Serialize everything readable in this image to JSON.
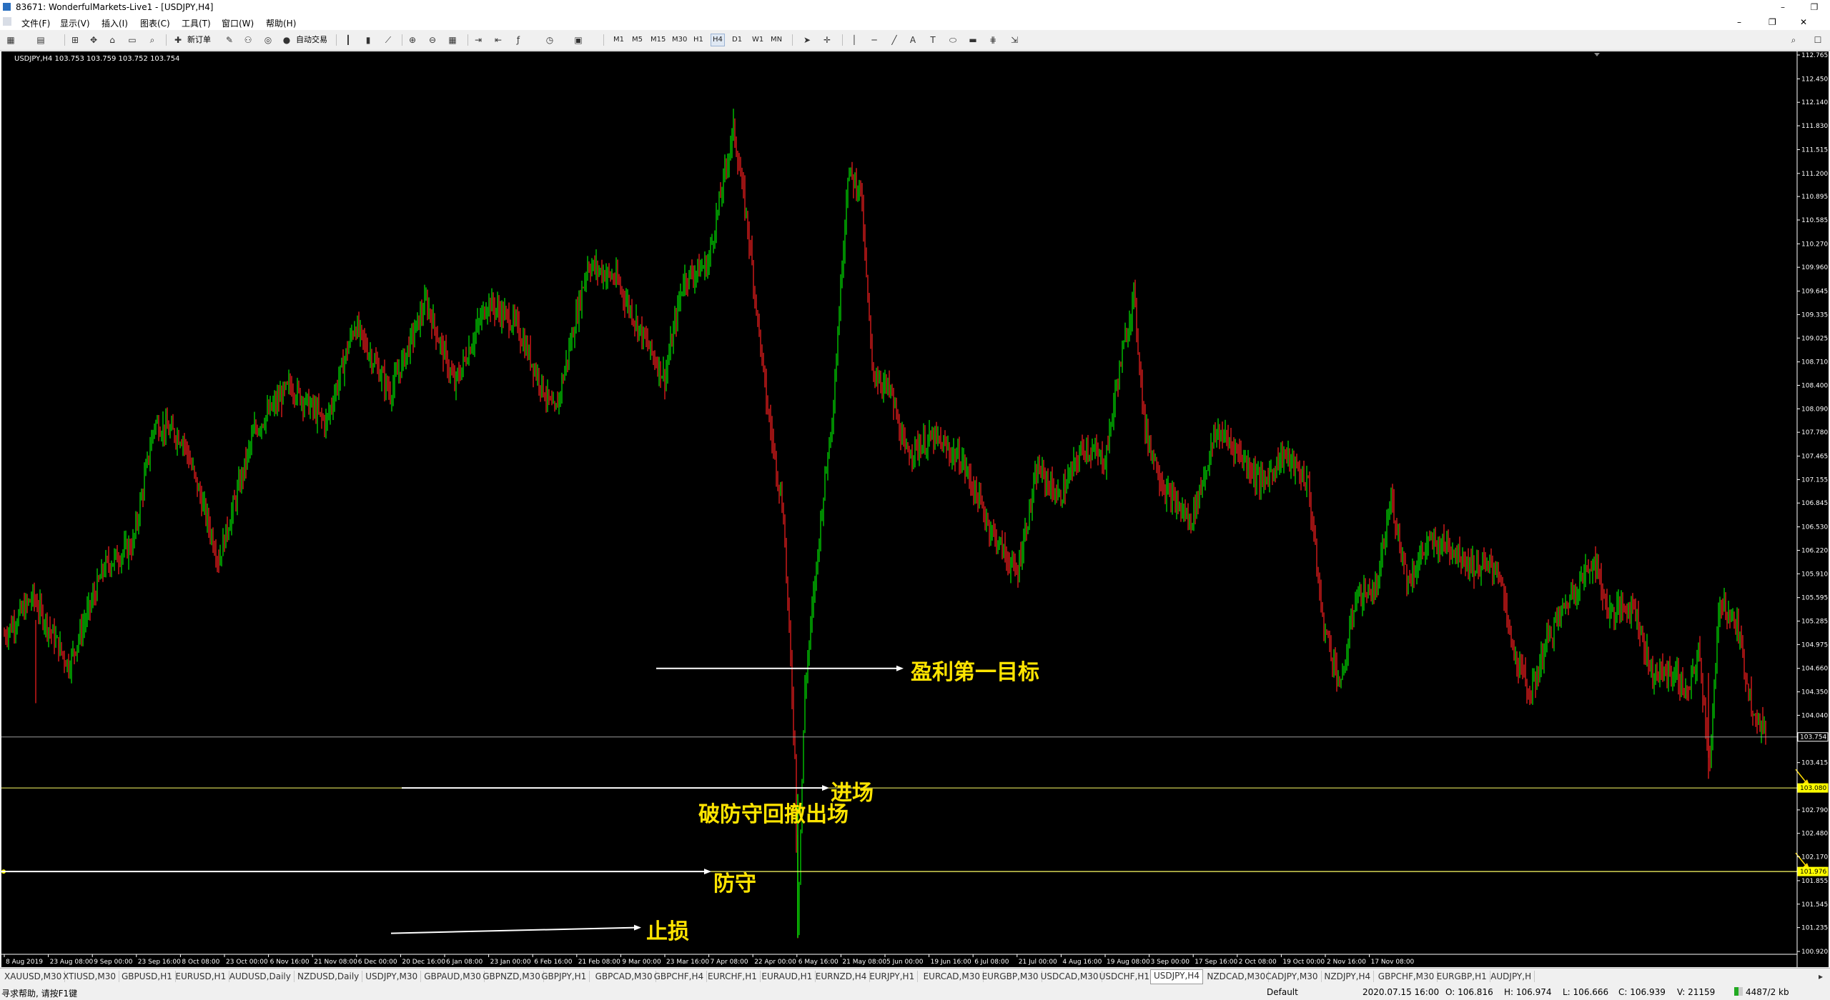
{
  "window": {
    "title": "83671: WonderfulMarkets-Live1 - [USDJPY,H4]"
  },
  "menu": [
    "文件(F)",
    "显示(V)",
    "插入(I)",
    "图表(C)",
    "工具(T)",
    "窗口(W)",
    "帮助(H)"
  ],
  "toolbar": {
    "new_order": "新订单",
    "auto_trading": "自动交易",
    "timeframes": [
      "M1",
      "M5",
      "M15",
      "M30",
      "H1",
      "H4",
      "D1",
      "W1",
      "MN"
    ],
    "selected_timeframe": "H4"
  },
  "chart_data": {
    "type": "candlestick",
    "symbol_header": "USDJPY,H4  103.753 103.759 103.752 103.754",
    "x_ticks": [
      "8 Aug 2019",
      "23 Aug 08:00",
      "9 Sep 00:00",
      "23 Sep 16:00",
      "8 Oct 08:00",
      "23 Oct 00:00",
      "6 Nov 16:00",
      "21 Nov 08:00",
      "6 Dec 00:00",
      "20 Dec 16:00",
      "6 Jan 08:00",
      "23 Jan 00:00",
      "6 Feb 16:00",
      "21 Feb 08:00",
      "9 Mar 00:00",
      "23 Mar 16:00",
      "7 Apr 08:00",
      "22 Apr 00:00",
      "6 May 16:00",
      "21 May 08:00",
      "5 Jun 00:00",
      "19 Jun 16:00",
      "6 Jul 08:00",
      "21 Jul 00:00",
      "4 Aug 16:00",
      "19 Aug 08:00",
      "3 Sep 00:00",
      "17 Sep 16:00",
      "2 Oct 08:00",
      "19 Oct 00:00",
      "2 Nov 16:00",
      "17 Nov 08:00"
    ],
    "y_ticks": [
      "112.765",
      "112.450",
      "112.140",
      "111.830",
      "111.515",
      "111.200",
      "110.895",
      "110.585",
      "110.270",
      "109.960",
      "109.645",
      "109.335",
      "109.025",
      "108.710",
      "108.400",
      "108.090",
      "107.780",
      "107.465",
      "107.155",
      "106.845",
      "106.530",
      "106.220",
      "105.910",
      "105.595",
      "105.285",
      "104.975",
      "104.660",
      "104.350",
      "104.040",
      "103.730",
      "103.415",
      "103.105",
      "102.790",
      "102.480",
      "102.170",
      "101.855",
      "101.545",
      "101.235",
      "100.920"
    ],
    "ylim": [
      100.92,
      112.765
    ],
    "price_tags": [
      {
        "value": "103.754",
        "kind": "bid"
      },
      {
        "value": "103.080",
        "kind": "entry"
      },
      {
        "value": "101.976",
        "kind": "defense"
      }
    ],
    "path_points": [
      [
        0,
        105.1
      ],
      [
        20,
        105.6
      ],
      [
        45,
        104.7
      ],
      [
        70,
        106.0
      ],
      [
        90,
        106.3
      ],
      [
        105,
        107.9
      ],
      [
        125,
        107.7
      ],
      [
        150,
        106.1
      ],
      [
        175,
        107.8
      ],
      [
        200,
        108.4
      ],
      [
        225,
        107.9
      ],
      [
        245,
        109.2
      ],
      [
        270,
        108.3
      ],
      [
        295,
        109.5
      ],
      [
        315,
        108.4
      ],
      [
        338,
        109.5
      ],
      [
        358,
        109.2
      ],
      [
        385,
        108.0
      ],
      [
        408,
        110.0
      ],
      [
        428,
        109.8
      ],
      [
        448,
        109.0
      ],
      [
        462,
        108.5
      ],
      [
        475,
        109.8
      ],
      [
        492,
        110.0
      ],
      [
        510,
        111.8
      ],
      [
        520,
        110.5
      ],
      [
        533,
        108.2
      ],
      [
        545,
        106.7
      ],
      [
        553,
        103.5
      ],
      [
        555,
        101.3
      ],
      [
        560,
        104.4
      ],
      [
        572,
        106.8
      ],
      [
        580,
        108.2
      ],
      [
        590,
        111.2
      ],
      [
        599,
        111.0
      ],
      [
        607,
        108.6
      ],
      [
        620,
        108.3
      ],
      [
        630,
        107.5
      ],
      [
        650,
        107.7
      ],
      [
        670,
        107.4
      ],
      [
        690,
        106.5
      ],
      [
        708,
        105.9
      ],
      [
        723,
        107.3
      ],
      [
        738,
        106.9
      ],
      [
        755,
        107.6
      ],
      [
        770,
        107.4
      ],
      [
        778,
        108.4
      ],
      [
        790,
        109.6
      ],
      [
        798,
        107.8
      ],
      [
        812,
        107.0
      ],
      [
        830,
        106.6
      ],
      [
        848,
        107.8
      ],
      [
        860,
        107.6
      ],
      [
        880,
        107.1
      ],
      [
        895,
        107.5
      ],
      [
        912,
        107.1
      ],
      [
        922,
        105.3
      ],
      [
        935,
        104.4
      ],
      [
        945,
        105.6
      ],
      [
        960,
        105.7
      ],
      [
        970,
        106.9
      ],
      [
        982,
        105.8
      ],
      [
        995,
        106.3
      ],
      [
        1010,
        106.3
      ],
      [
        1028,
        106.0
      ],
      [
        1045,
        106.0
      ],
      [
        1055,
        104.9
      ],
      [
        1068,
        104.3
      ],
      [
        1078,
        105.0
      ],
      [
        1095,
        105.6
      ],
      [
        1112,
        106.1
      ],
      [
        1122,
        105.4
      ],
      [
        1140,
        105.5
      ],
      [
        1152,
        104.6
      ],
      [
        1168,
        104.6
      ],
      [
        1178,
        104.3
      ],
      [
        1185,
        104.9
      ],
      [
        1193,
        103.4
      ],
      [
        1200,
        105.6
      ],
      [
        1212,
        105.2
      ],
      [
        1222,
        104.2
      ],
      [
        1232,
        103.75
      ]
    ],
    "annotations": [
      {
        "text": "盈利第一目标",
        "level": 104.66
      },
      {
        "text": "进场",
        "level": 103.08
      },
      {
        "text": "破防守回撤出场",
        "level": 102.48
      },
      {
        "text": "防守",
        "level": 101.976
      },
      {
        "text": "止损",
        "level": 101.235
      }
    ]
  },
  "symbol_tabs": [
    "XAUUSD,M30",
    "XTIUSD,M30",
    "GBPUSD,H1",
    "EURUSD,H1",
    "AUDUSD,Daily",
    "NZDUSD,Daily",
    "USDJPY,M30",
    "GBPAUD,M30",
    "GBPNZD,M30",
    "GBPJPY,H1",
    "GBPCAD,M30",
    "GBPCHF,H4",
    "EURCHF,H1",
    "EURAUD,H1",
    "EURNZD,H4",
    "EURJPY,H1",
    "EURCAD,M30",
    "EURGBP,M30",
    "USDCAD,M30",
    "USDCHF,H1",
    "USDJPY,H4",
    "NZDCAD,M30",
    "CADJPY,M30",
    "NZDJPY,H4",
    "GBPCHF,M30",
    "EURGBP,H1",
    "AUDJPY,H"
  ],
  "selected_tab": "USDJPY,H4",
  "status": {
    "help": "寻求帮助, 请按F1键",
    "profile": "Default",
    "datetime": "2020.07.15 16:00",
    "open": "O: 106.816",
    "high": "H: 106.974",
    "low": "L: 106.666",
    "close": "C: 106.939",
    "volume": "V: 21159",
    "traffic": "4487/2 kb"
  }
}
